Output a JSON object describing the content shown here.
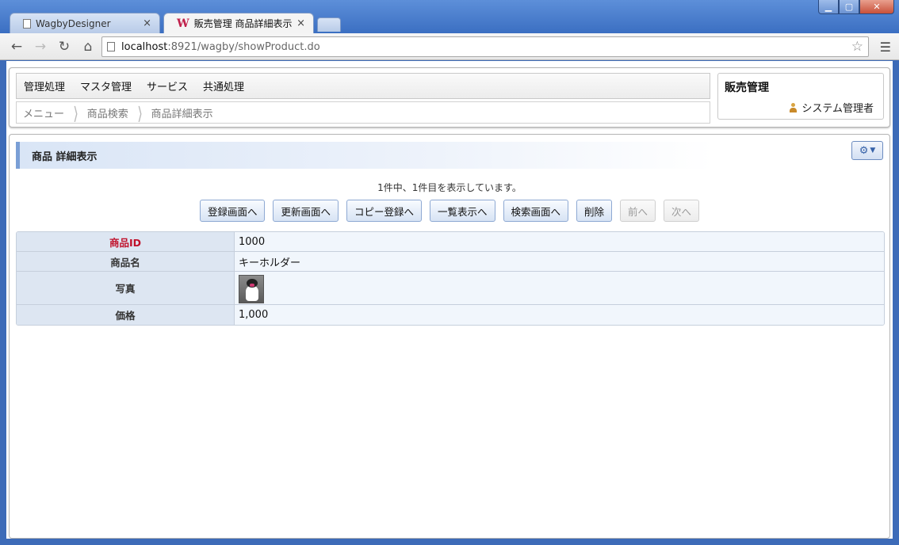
{
  "browser": {
    "tabs": [
      {
        "title": "WagbyDesigner",
        "active": false
      },
      {
        "title": "販売管理 商品詳細表示",
        "active": true
      }
    ],
    "tab_close_glyph": "×",
    "url_host": "localhost",
    "url_path": ":8921/wagby/showProduct.do",
    "icons": [
      "back-icon",
      "forward-icon",
      "reload-icon",
      "home-icon",
      "page-icon",
      "star-icon",
      "menu-icon"
    ]
  },
  "header": {
    "menu": [
      "管理処理",
      "マスタ管理",
      "サービス",
      "共通処理"
    ],
    "breadcrumb": [
      "メニュー",
      "商品検索",
      "商品詳細表示"
    ],
    "app_title": "販売管理",
    "user_name": "システム管理者"
  },
  "content": {
    "section_title": "商品 詳細表示",
    "status": "1件中、1件目を表示しています。",
    "buttons": [
      {
        "label": "登録画面へ",
        "enabled": true
      },
      {
        "label": "更新画面へ",
        "enabled": true
      },
      {
        "label": "コピー登録へ",
        "enabled": true
      },
      {
        "label": "一覧表示へ",
        "enabled": true
      },
      {
        "label": "検索画面へ",
        "enabled": true
      },
      {
        "label": "削除",
        "enabled": true
      },
      {
        "label": "前へ",
        "enabled": false
      },
      {
        "label": "次へ",
        "enabled": false
      }
    ],
    "fields": [
      {
        "label": "商品ID",
        "value": "1000",
        "key": true
      },
      {
        "label": "商品名",
        "value": "キーホルダー",
        "key": false
      },
      {
        "label": "写真",
        "value": "",
        "key": false
      },
      {
        "label": "価格",
        "value": "1,000",
        "key": false
      }
    ]
  },
  "colors": {
    "accent": "#7a9fd6",
    "key_label": "#c0102a",
    "label_bg": "#dde6f2",
    "value_bg": "#f1f6fc"
  }
}
